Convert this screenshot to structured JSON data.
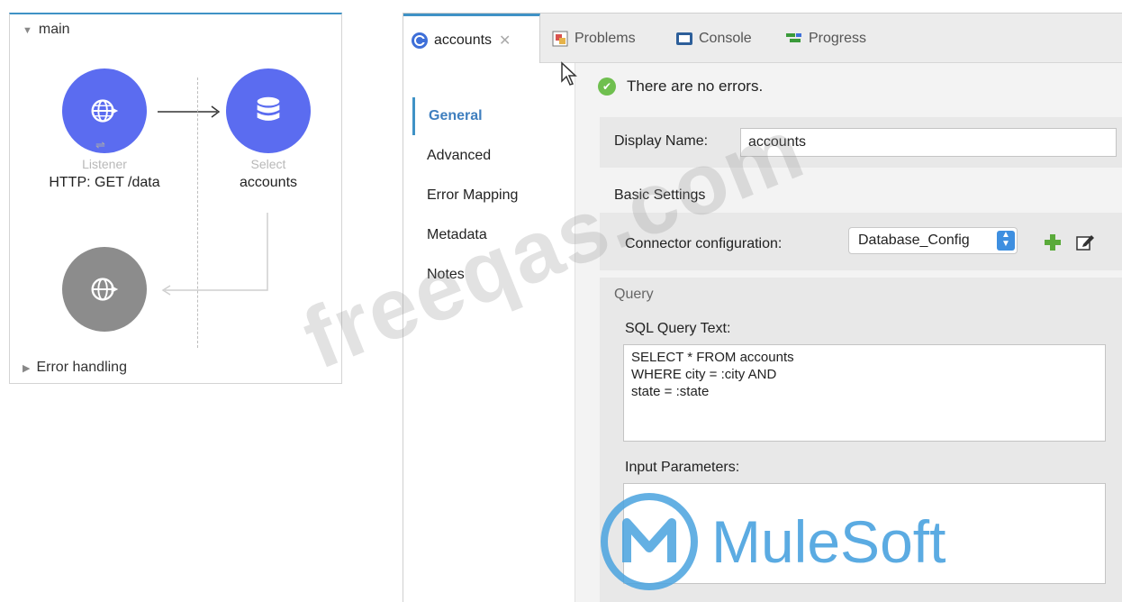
{
  "flow": {
    "name": "main",
    "listener": {
      "type": "Listener",
      "label": "HTTP: GET /data"
    },
    "select": {
      "type": "Select",
      "label": "accounts"
    },
    "error_handling": "Error handling"
  },
  "tabs": [
    {
      "label": "accounts",
      "icon": "mule-component-icon"
    },
    {
      "label": "Problems",
      "icon": "problems-icon"
    },
    {
      "label": "Console",
      "icon": "console-icon"
    },
    {
      "label": "Progress",
      "icon": "progress-icon"
    }
  ],
  "nav": [
    "General",
    "Advanced",
    "Error Mapping",
    "Metadata",
    "Notes"
  ],
  "status": "There are no errors.",
  "general": {
    "display_name_label": "Display Name:",
    "display_name_value": "accounts",
    "basic_settings": "Basic Settings",
    "connector_label": "Connector configuration:",
    "connector_value": "Database_Config",
    "query_section": "Query",
    "sql_label": "SQL Query Text:",
    "sql_text": "SELECT * FROM accounts\nWHERE city = :city AND\nstate = :state",
    "input_params_label": "Input Parameters:"
  },
  "watermark": "freeqas.com",
  "brand": "MuleSoft",
  "colors": {
    "node_blue": "#5b6cf0",
    "node_gray": "#8c8c8c",
    "accent": "#3f92c6",
    "mulesoft": "#4aa3df"
  }
}
